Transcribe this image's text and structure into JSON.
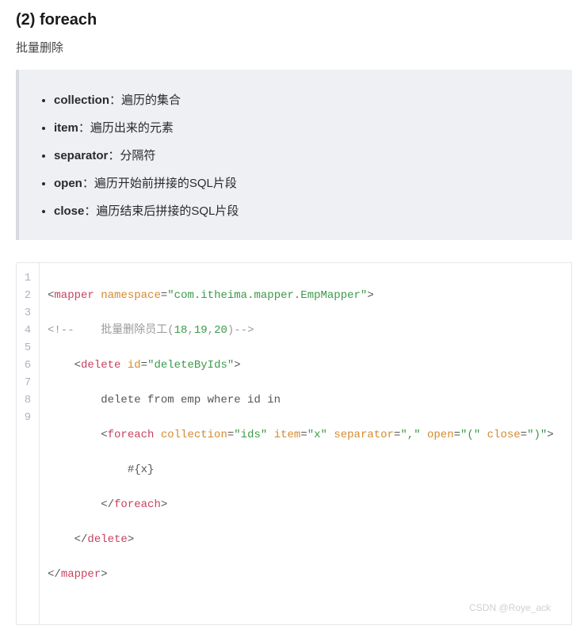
{
  "heading": "(2)  foreach",
  "subtitle": "批量删除",
  "attrs": [
    {
      "term": "collection",
      "desc": "遍历的集合"
    },
    {
      "term": "item",
      "desc": "遍历出来的元素"
    },
    {
      "term": "separator",
      "desc": "分隔符"
    },
    {
      "term": "open",
      "desc": "遍历开始前拼接的SQL片段"
    },
    {
      "term": "close",
      "desc": "遍历结束后拼接的SQL片段"
    }
  ],
  "code": {
    "line_numbers": [
      "1",
      "2",
      "3",
      "4",
      "5",
      "6",
      "7",
      "8",
      "9"
    ],
    "mapper_namespace": "com.itheima.mapper.EmpMapper",
    "comment_prefix": "<!--    批量删除员工(",
    "comment_nums": [
      "18",
      "19",
      "20"
    ],
    "comment_suffix": ")-->",
    "delete_id": "deleteByIds",
    "sql_text": "delete from emp where id in",
    "foreach_collection": "ids",
    "foreach_item": "x",
    "foreach_separator": ",",
    "foreach_open": "(",
    "foreach_close": ")",
    "foreach_body": "#{x}",
    "tag_mapper": "mapper",
    "tag_delete": "delete",
    "tag_foreach": "foreach",
    "kw_namespace": "namespace",
    "kw_id": "id",
    "kw_collection": "collection",
    "kw_item": "item",
    "kw_separator": "separator",
    "kw_open": "open",
    "kw_close": "close"
  },
  "watermark": "CSDN @Roye_ack"
}
